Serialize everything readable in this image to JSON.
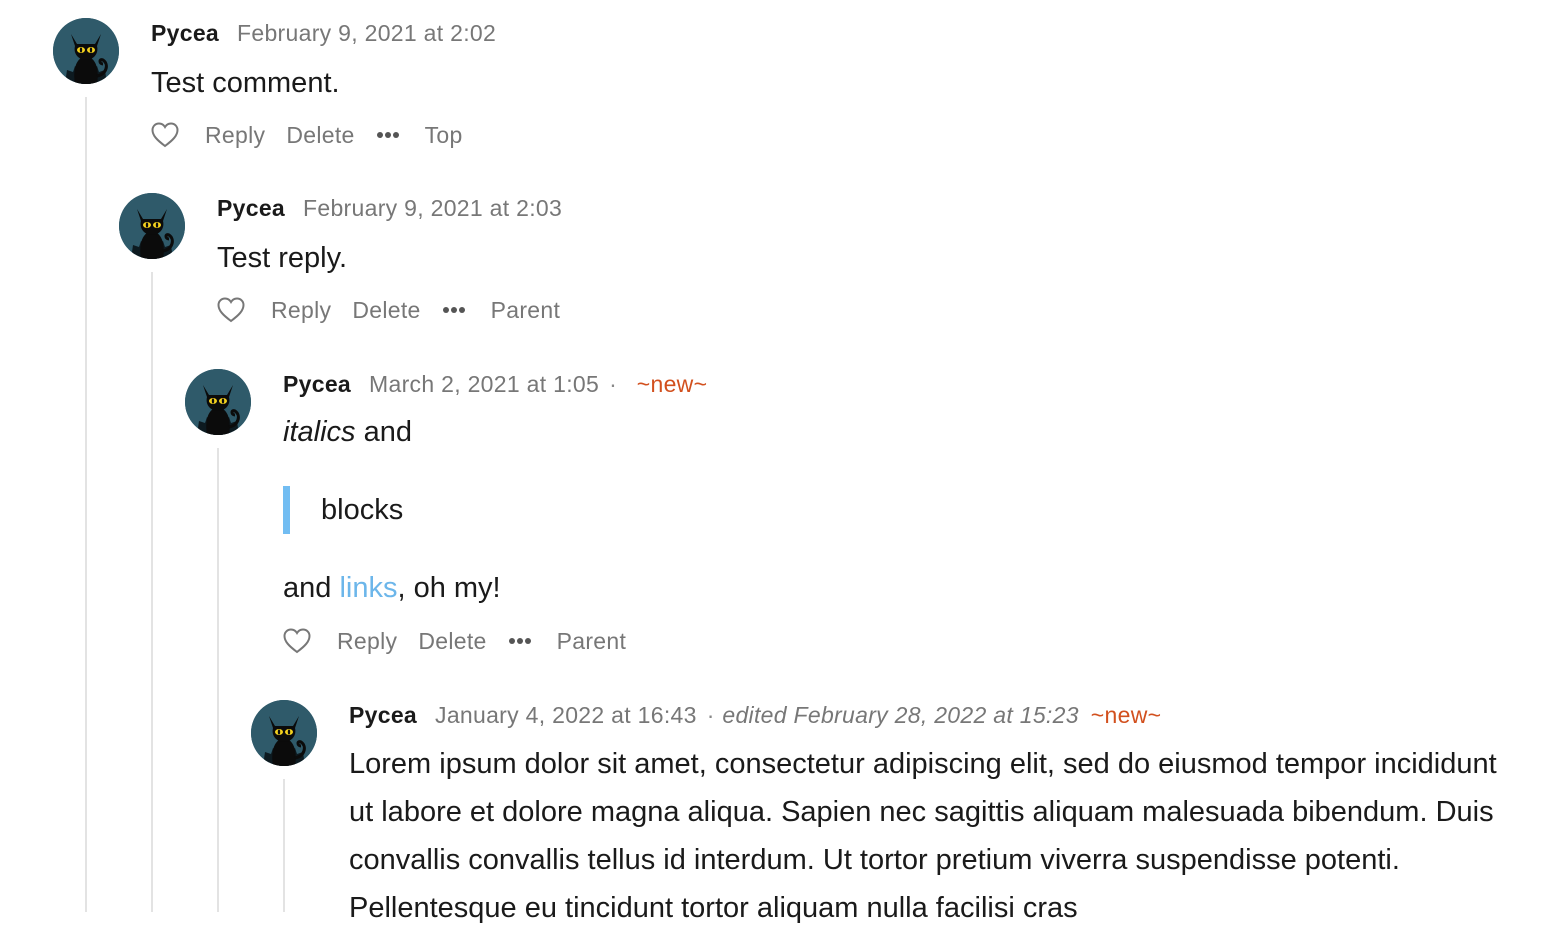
{
  "comments": [
    {
      "author": "Pycea",
      "date": "February 9, 2021 at 2:02",
      "body": "Test comment.",
      "actions": {
        "reply": "Reply",
        "delete": "Delete",
        "nav": "Top"
      }
    },
    {
      "author": "Pycea",
      "date": "February 9, 2021 at 2:03",
      "body": "Test reply.",
      "actions": {
        "reply": "Reply",
        "delete": "Delete",
        "nav": "Parent"
      }
    },
    {
      "author": "Pycea",
      "date": "March 2, 2021 at 1:05",
      "separator": "·",
      "new_tag": "~new~",
      "body_italic": "italics",
      "body_and": " and",
      "quote": "blocks",
      "body_and2": "and ",
      "link": "links",
      "body_tail": ", oh my!",
      "actions": {
        "reply": "Reply",
        "delete": "Delete",
        "nav": "Parent"
      }
    },
    {
      "author": "Pycea",
      "date": "January 4, 2022 at 16:43",
      "separator": "·",
      "edited": "edited February 28, 2022 at 15:23",
      "new_tag": "~new~",
      "body": "Lorem ipsum dolor sit amet, consectetur adipiscing elit, sed do eiusmod tempor incididunt ut labore et dolore magna aliqua. Sapien nec sagittis aliquam malesuada bibendum. Duis convallis convallis tellus id interdum. Ut tortor pretium viverra suspendisse potenti. Pellentesque eu tincidunt tortor aliquam nulla facilisi cras"
    }
  ],
  "colors": {
    "accent_new": "#d2501e",
    "link": "#6cb6ea",
    "quote_bar": "#72bdf2",
    "muted_text": "#777777",
    "avatar_bg": "#2f5a6a"
  },
  "icons": {
    "avatar": "black-cat-avatar-icon",
    "like": "heart-outline-icon",
    "more": "ellipsis-icon"
  }
}
